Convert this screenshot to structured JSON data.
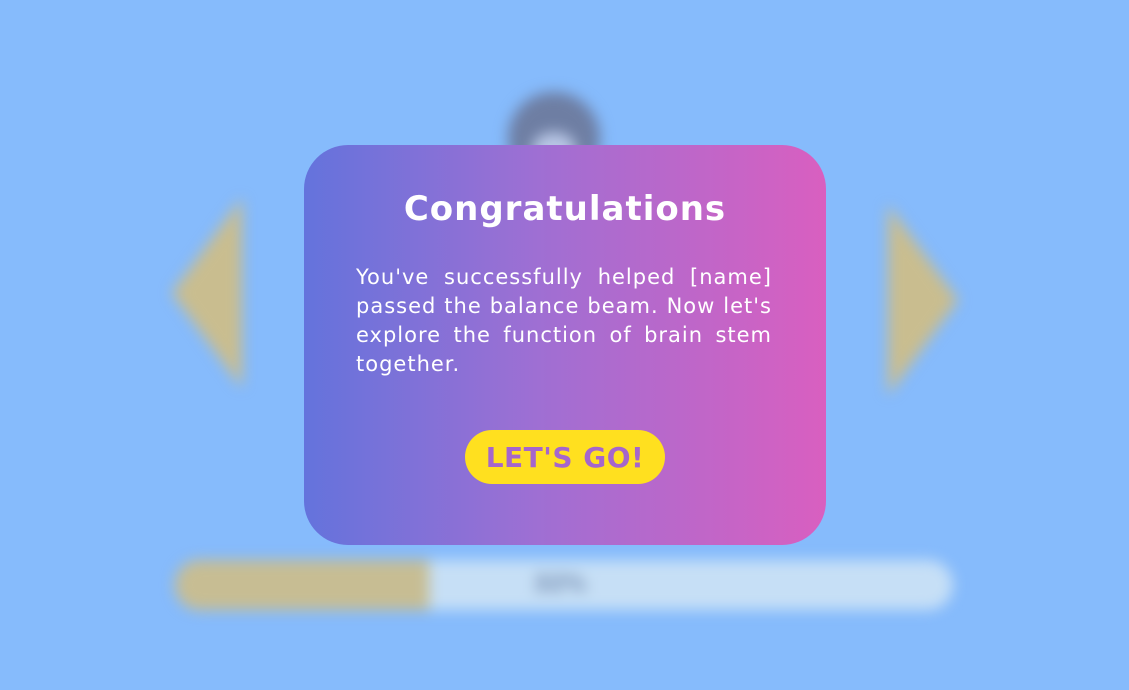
{
  "scene": {
    "progress": {
      "label": "32%",
      "value_percent": 32.6
    }
  },
  "modal": {
    "title": "Congratulations",
    "message": "You've successfully helped [name] passed the balance beam. Now let's explore the function of brain stem together.",
    "button_label": "LET'S GO!"
  },
  "colors": {
    "background": "#86bbfc",
    "modal_gradient_start": "#6473dc",
    "modal_gradient_end": "#d95fc0",
    "button_fill": "#ffe01f",
    "button_text": "#a566cc",
    "arrow": "#c9bd8f"
  }
}
